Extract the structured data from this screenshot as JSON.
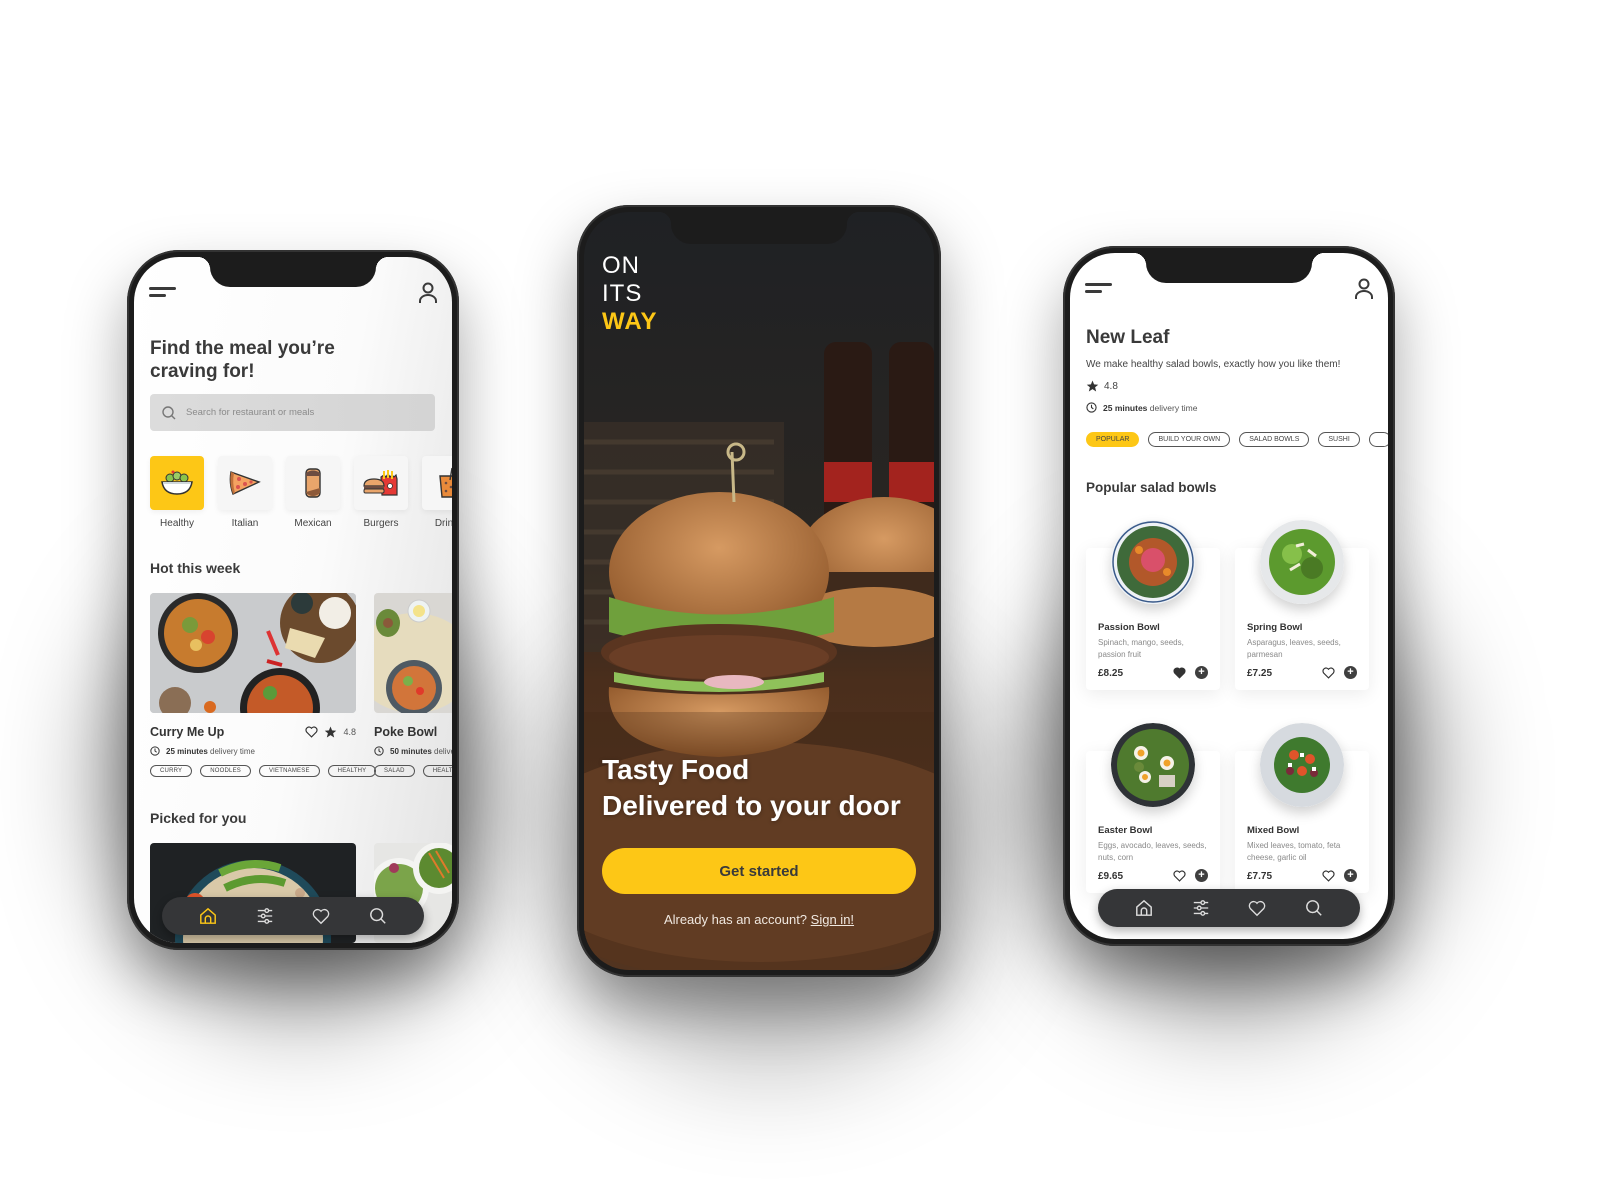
{
  "brand": {
    "accent": "#fdc716",
    "dark": "#353638",
    "text": "#3a3a3a"
  },
  "home_screen": {
    "headline": "Find the meal you’re craving for!",
    "search": {
      "placeholder": "Search for restaurant or meals",
      "value": ""
    },
    "categories": [
      {
        "label": "Healthy",
        "icon": "salad-bowl-icon",
        "active": true
      },
      {
        "label": "Italian",
        "icon": "pizza-slice-icon",
        "active": false
      },
      {
        "label": "Mexican",
        "icon": "burrito-icon",
        "active": false
      },
      {
        "label": "Burgers",
        "icon": "burger-fries-icon",
        "active": false
      },
      {
        "label": "Drinks",
        "icon": "drink-icon",
        "active": false
      }
    ],
    "hot_section_title": "Hot this week",
    "hot_items": [
      {
        "title": "Curry Me Up",
        "rating": "4.8",
        "delivery_minutes": "25 minutes",
        "delivery_suffix": "delivery time",
        "tags": [
          "CURRY",
          "NOODLES",
          "VIETNAMESE",
          "HEALTHY"
        ]
      },
      {
        "title": "Poke Bowl",
        "rating": "",
        "delivery_minutes": "50 minutes",
        "delivery_suffix": "delivery time",
        "tags": [
          "SALAD",
          "HEALTHY"
        ]
      }
    ],
    "picked_section_title": "Picked for you",
    "nav": [
      {
        "icon": "home-icon",
        "active": true
      },
      {
        "icon": "filters-icon",
        "active": false
      },
      {
        "icon": "heart-icon",
        "active": false
      },
      {
        "icon": "search-icon",
        "active": false
      }
    ]
  },
  "welcome_screen": {
    "logo_lines": [
      "ON",
      "ITS",
      "WAY"
    ],
    "hero_line_1": "Tasty Food",
    "hero_line_2": "Delivered to your door",
    "cta_label": "Get started",
    "signin_prompt": "Already has an account?",
    "signin_link": "Sign in!"
  },
  "restaurant_screen": {
    "name": "New Leaf",
    "description": "We make healthy salad bowls, exactly how you like them!",
    "rating": "4.8",
    "delivery_minutes": "25 minutes",
    "delivery_suffix": "delivery time",
    "chips": [
      {
        "label": "POPULAR",
        "active": true
      },
      {
        "label": "BUILD YOUR OWN",
        "active": false
      },
      {
        "label": "SALAD BOWLS",
        "active": false
      },
      {
        "label": "SUSHI",
        "active": false
      }
    ],
    "section_title": "Popular salad bowls",
    "bowls": [
      {
        "name": "Passion Bowl",
        "description": "Spinach, mango, seeds, passion fruit",
        "price": "£8.25",
        "favorited": true
      },
      {
        "name": "Spring Bowl",
        "description": "Asparagus, leaves, seeds, parmesan",
        "price": "£7.25",
        "favorited": false
      },
      {
        "name": "Easter Bowl",
        "description": "Eggs, avocado, leaves, seeds, nuts, corn",
        "price": "£9.65",
        "favorited": false
      },
      {
        "name": "Mixed Bowl",
        "description": "Mixed leaves, tomato, feta cheese, garlic oil",
        "price": "£7.75",
        "favorited": false
      }
    ],
    "add_symbol": "+"
  }
}
